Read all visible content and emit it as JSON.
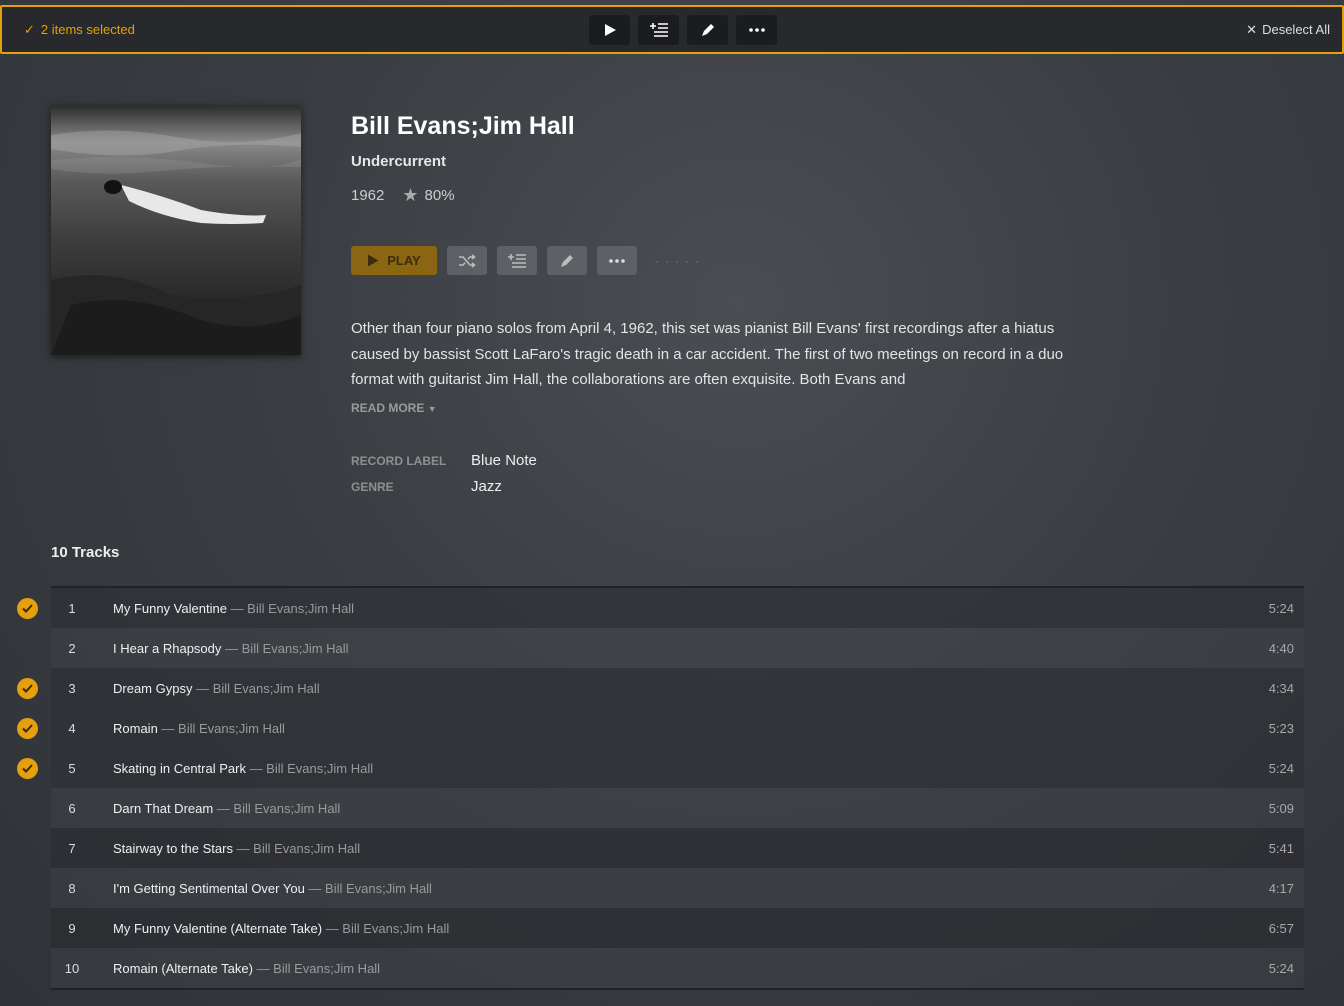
{
  "selection_bar": {
    "count_text": "2 items selected",
    "deselect_label": "Deselect All"
  },
  "album": {
    "artist": "Bill Evans;Jim Hall",
    "title": "Undercurrent",
    "year": "1962",
    "rating": "80%",
    "play_label": "PLAY",
    "summary": "Other than four piano solos from April 4, 1962, this set was pianist Bill Evans' first recordings after a hiatus caused by bassist Scott LaFaro's tragic death in a car accident. The first of two meetings on record in a duo format with guitarist Jim Hall, the collaborations are often exquisite. Both Evans and",
    "read_more": "READ MORE",
    "details": [
      {
        "label": "RECORD LABEL",
        "value": "Blue Note"
      },
      {
        "label": "GENRE",
        "value": "Jazz"
      }
    ]
  },
  "tracks_header": "10 Tracks",
  "tracks": [
    {
      "num": "1",
      "title": "My Funny Valentine",
      "artist": "Bill Evans;Jim Hall",
      "duration": "5:24",
      "selected": true
    },
    {
      "num": "2",
      "title": "I Hear a Rhapsody",
      "artist": "Bill Evans;Jim Hall",
      "duration": "4:40",
      "selected": false
    },
    {
      "num": "3",
      "title": "Dream Gypsy",
      "artist": "Bill Evans;Jim Hall",
      "duration": "4:34",
      "selected": true
    },
    {
      "num": "4",
      "title": "Romain",
      "artist": "Bill Evans;Jim Hall",
      "duration": "5:23",
      "selected": true
    },
    {
      "num": "5",
      "title": "Skating in Central Park",
      "artist": "Bill Evans;Jim Hall",
      "duration": "5:24",
      "selected": true
    },
    {
      "num": "6",
      "title": "Darn That Dream",
      "artist": "Bill Evans;Jim Hall",
      "duration": "5:09",
      "selected": false
    },
    {
      "num": "7",
      "title": "Stairway to the Stars",
      "artist": "Bill Evans;Jim Hall",
      "duration": "5:41",
      "selected": false
    },
    {
      "num": "8",
      "title": "I'm Getting Sentimental Over You",
      "artist": "Bill Evans;Jim Hall",
      "duration": "4:17",
      "selected": false
    },
    {
      "num": "9",
      "title": "My Funny Valentine (Alternate Take)",
      "artist": "Bill Evans;Jim Hall",
      "duration": "6:57",
      "selected": false
    },
    {
      "num": "10",
      "title": "Romain (Alternate Take)",
      "artist": "Bill Evans;Jim Hall",
      "duration": "5:24",
      "selected": false
    }
  ],
  "colors": {
    "accent": "#e5a00d",
    "background": "#3a3d42"
  },
  "icons": [
    "check-icon",
    "play-icon",
    "add-to-queue-icon",
    "edit-icon",
    "more-icon",
    "close-icon",
    "shuffle-icon",
    "star-icon",
    "chevron-down-icon"
  ]
}
